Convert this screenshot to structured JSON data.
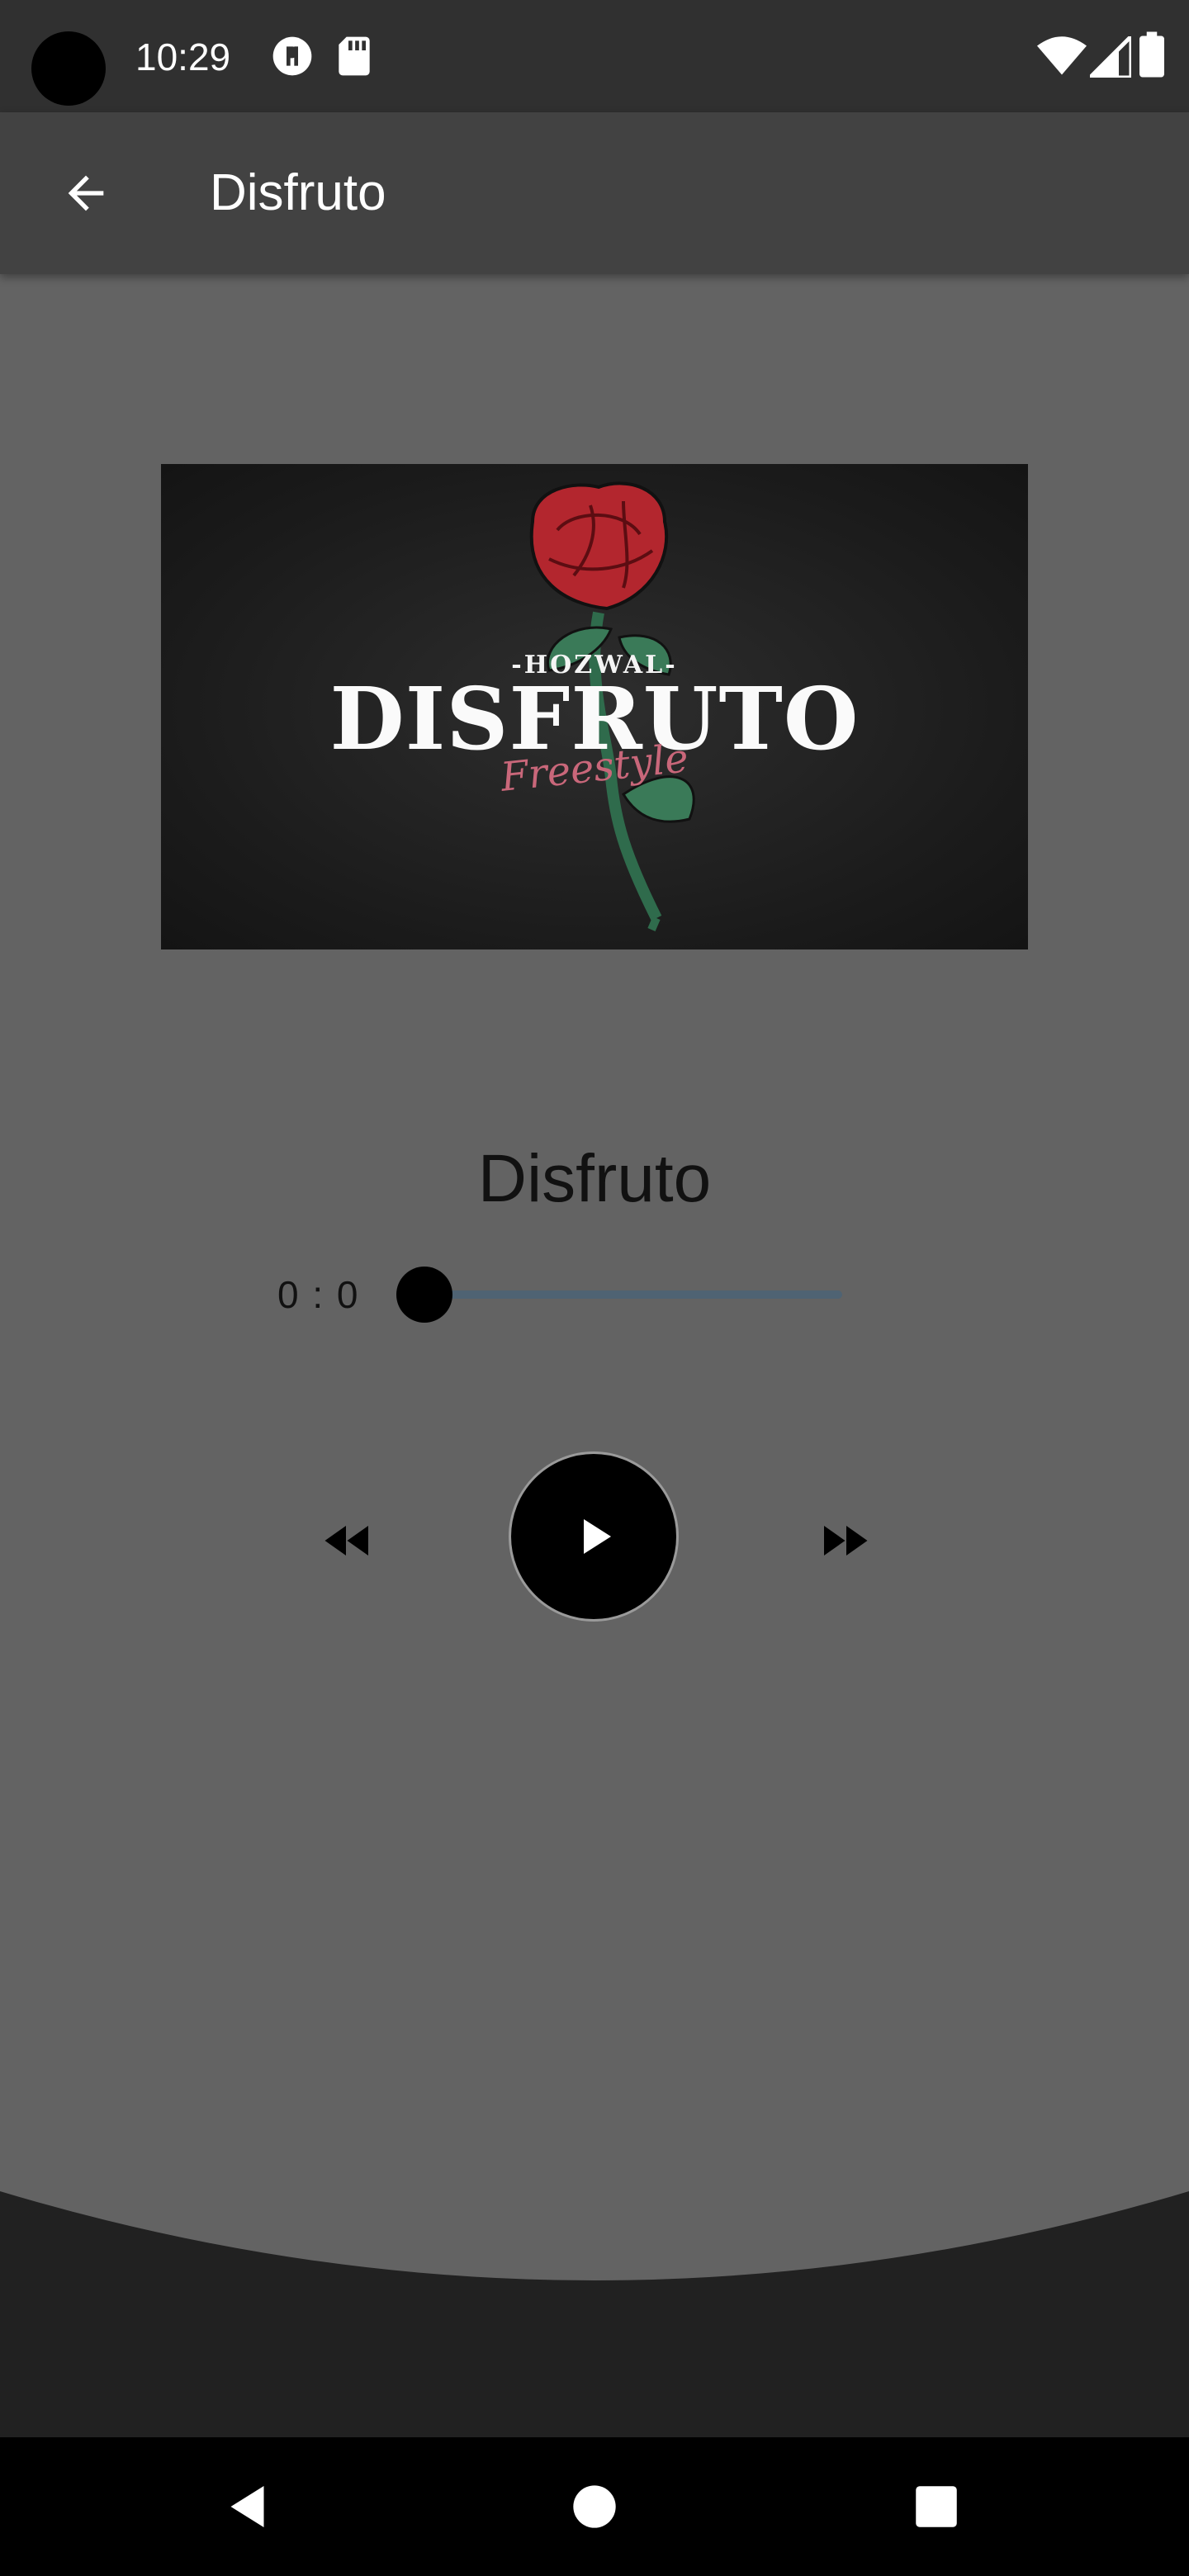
{
  "status_bar": {
    "time": "10:29",
    "icons": [
      "camera-cutout",
      "vpn-key-icon",
      "sd-card-icon",
      "wifi-icon",
      "signal-icon",
      "battery-icon"
    ]
  },
  "app_bar": {
    "title": "Disfruto",
    "back_icon": "arrow-left-icon"
  },
  "artwork": {
    "artist_text": "-HOZWAL-",
    "title_text": "DISFRUTO",
    "subtitle_text": "Freestyle",
    "colors": {
      "rose": "#b3262e",
      "stem": "#2f6b4c",
      "background": "#1b1b1b"
    }
  },
  "player": {
    "track_title": "Disfruto",
    "elapsed": "0 : 0",
    "progress": 0,
    "controls": {
      "rewind_icon": "fast-rewind-icon",
      "play_icon": "play-icon",
      "forward_icon": "fast-forward-icon"
    }
  },
  "nav_bar": {
    "icons": [
      "back-triangle-icon",
      "home-circle-icon",
      "recents-square-icon"
    ]
  },
  "colors": {
    "background": "#636363",
    "status_bar": "#303030",
    "app_bar": "#424242",
    "bottom_panel": "#212121",
    "seek_track": "#4f6373"
  }
}
